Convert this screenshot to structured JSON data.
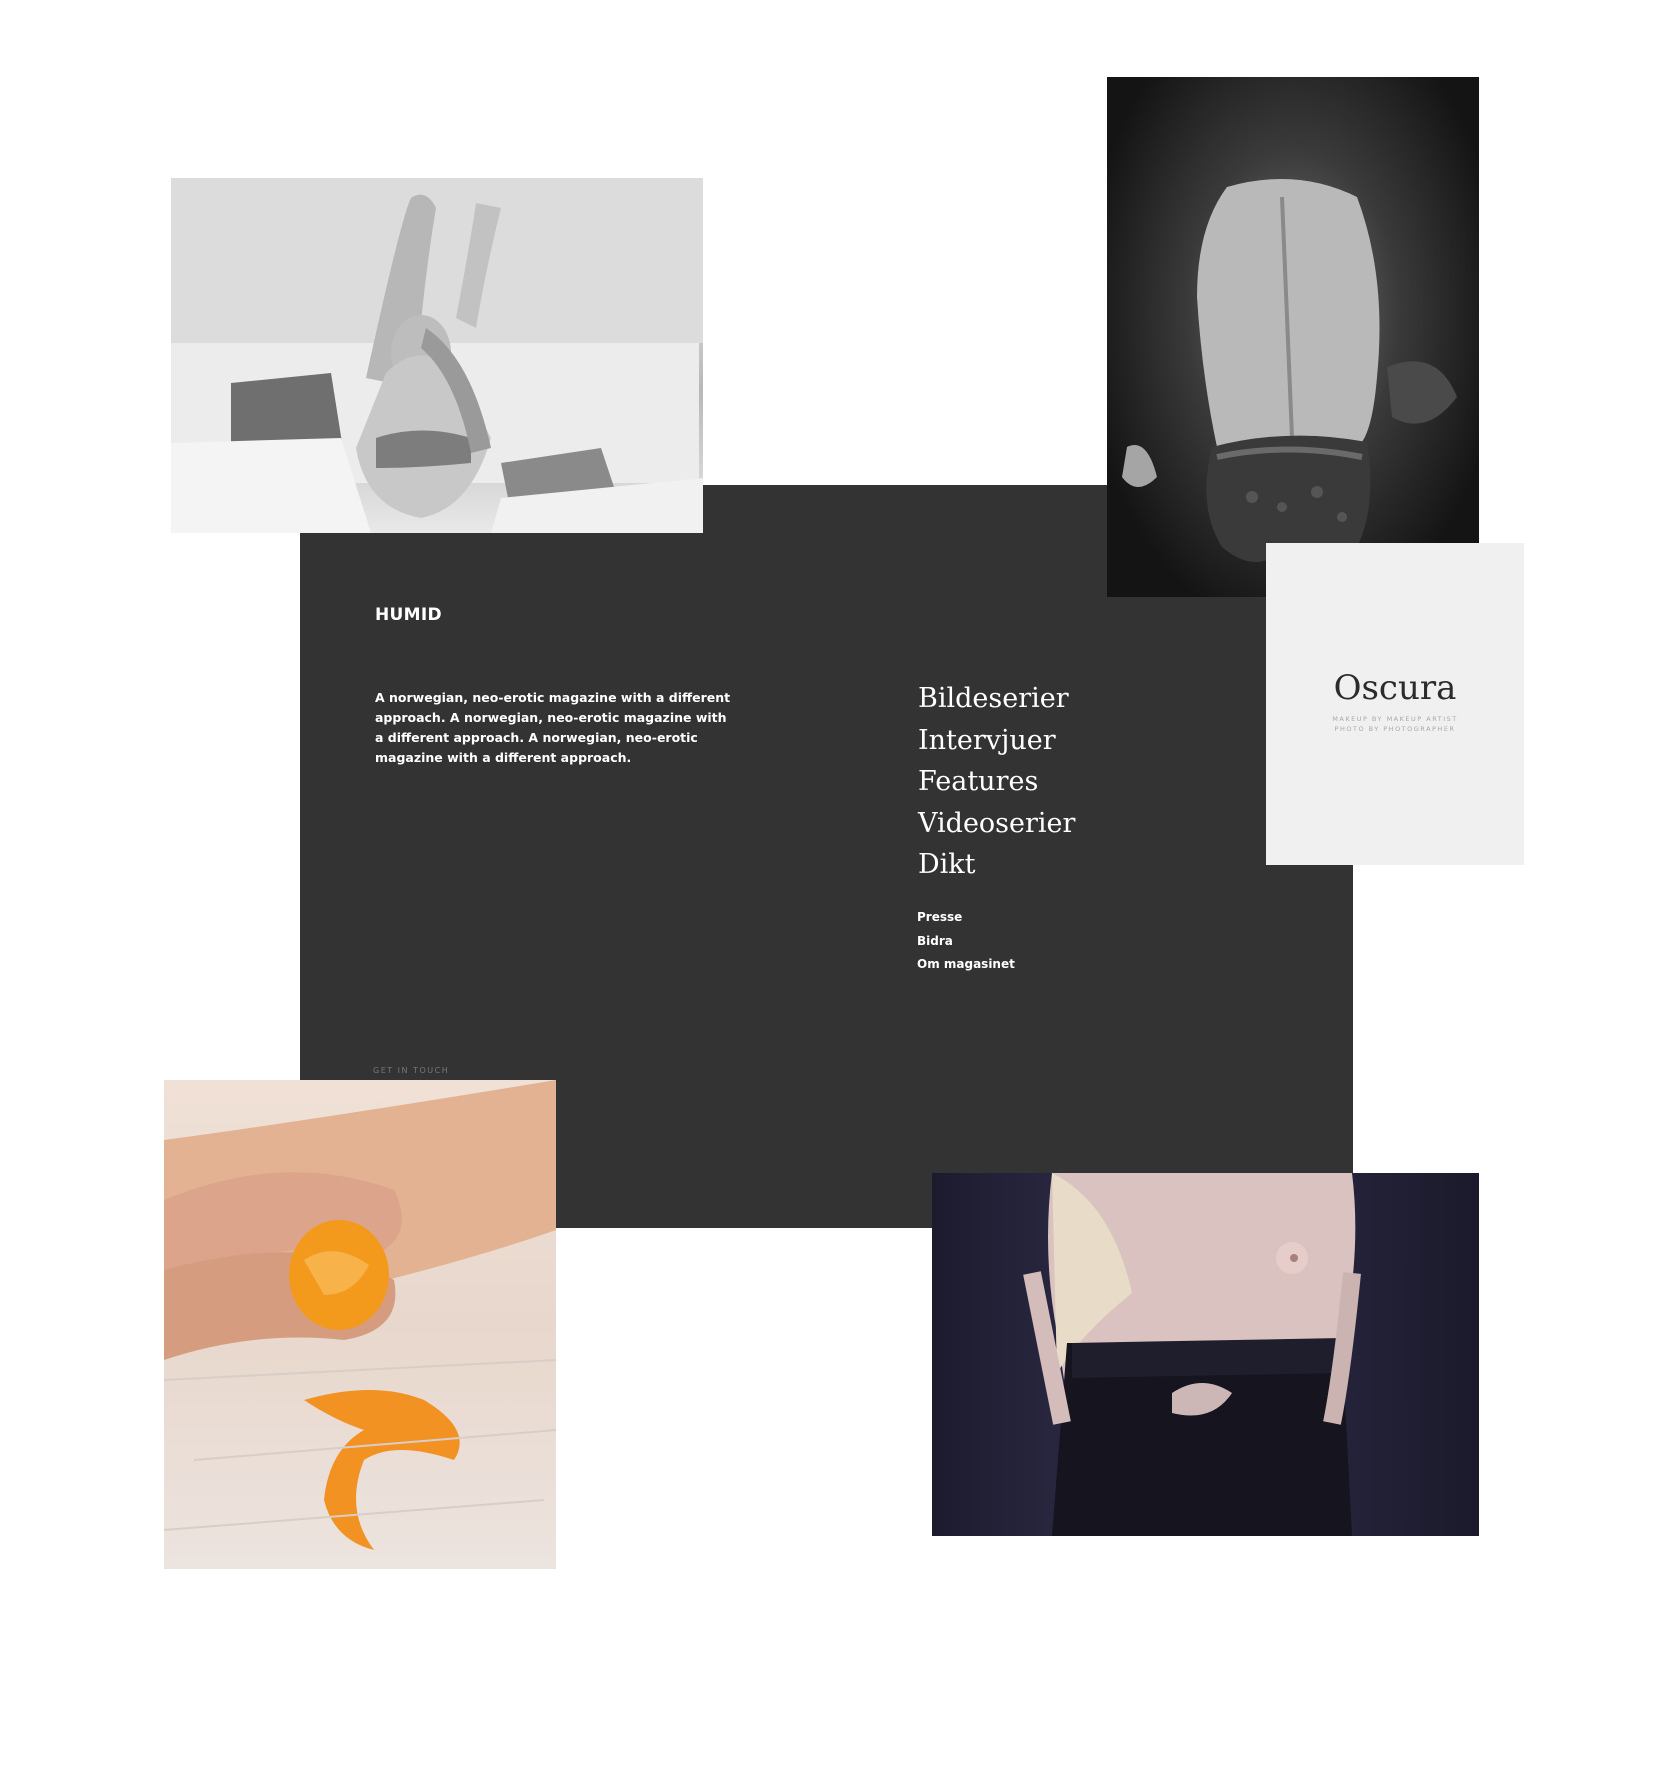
{
  "brand": "HUMID",
  "intro": "A norwegian, neo-erotic magazine with a different approach. A norwegian, neo-erotic magazine with a different approach. A norwegian, neo-erotic magazine with a different approach.",
  "main_nav": [
    "Bildeserier",
    "Intervjuer",
    "Features",
    "Videoserier",
    "Dikt"
  ],
  "sub_nav": [
    "Presse",
    "Bidra",
    "Om magasinet"
  ],
  "footer_link": "GET IN TOUCH",
  "feature_card": {
    "title": "Oscura",
    "credit_line_1": "MAKEUP BY MAKEUP ARTIST",
    "credit_line_2": "PHOTO BY PHOTOGRAPHER"
  },
  "colors": {
    "panel": "#333333",
    "background": "#ffffff",
    "card": "#f0f0f0",
    "accent_orange": "#f39a1c"
  },
  "photos": [
    "bed-portrait-photo",
    "bare-back-photo",
    "orange-peeling-photo",
    "dark-portrait-photo"
  ]
}
